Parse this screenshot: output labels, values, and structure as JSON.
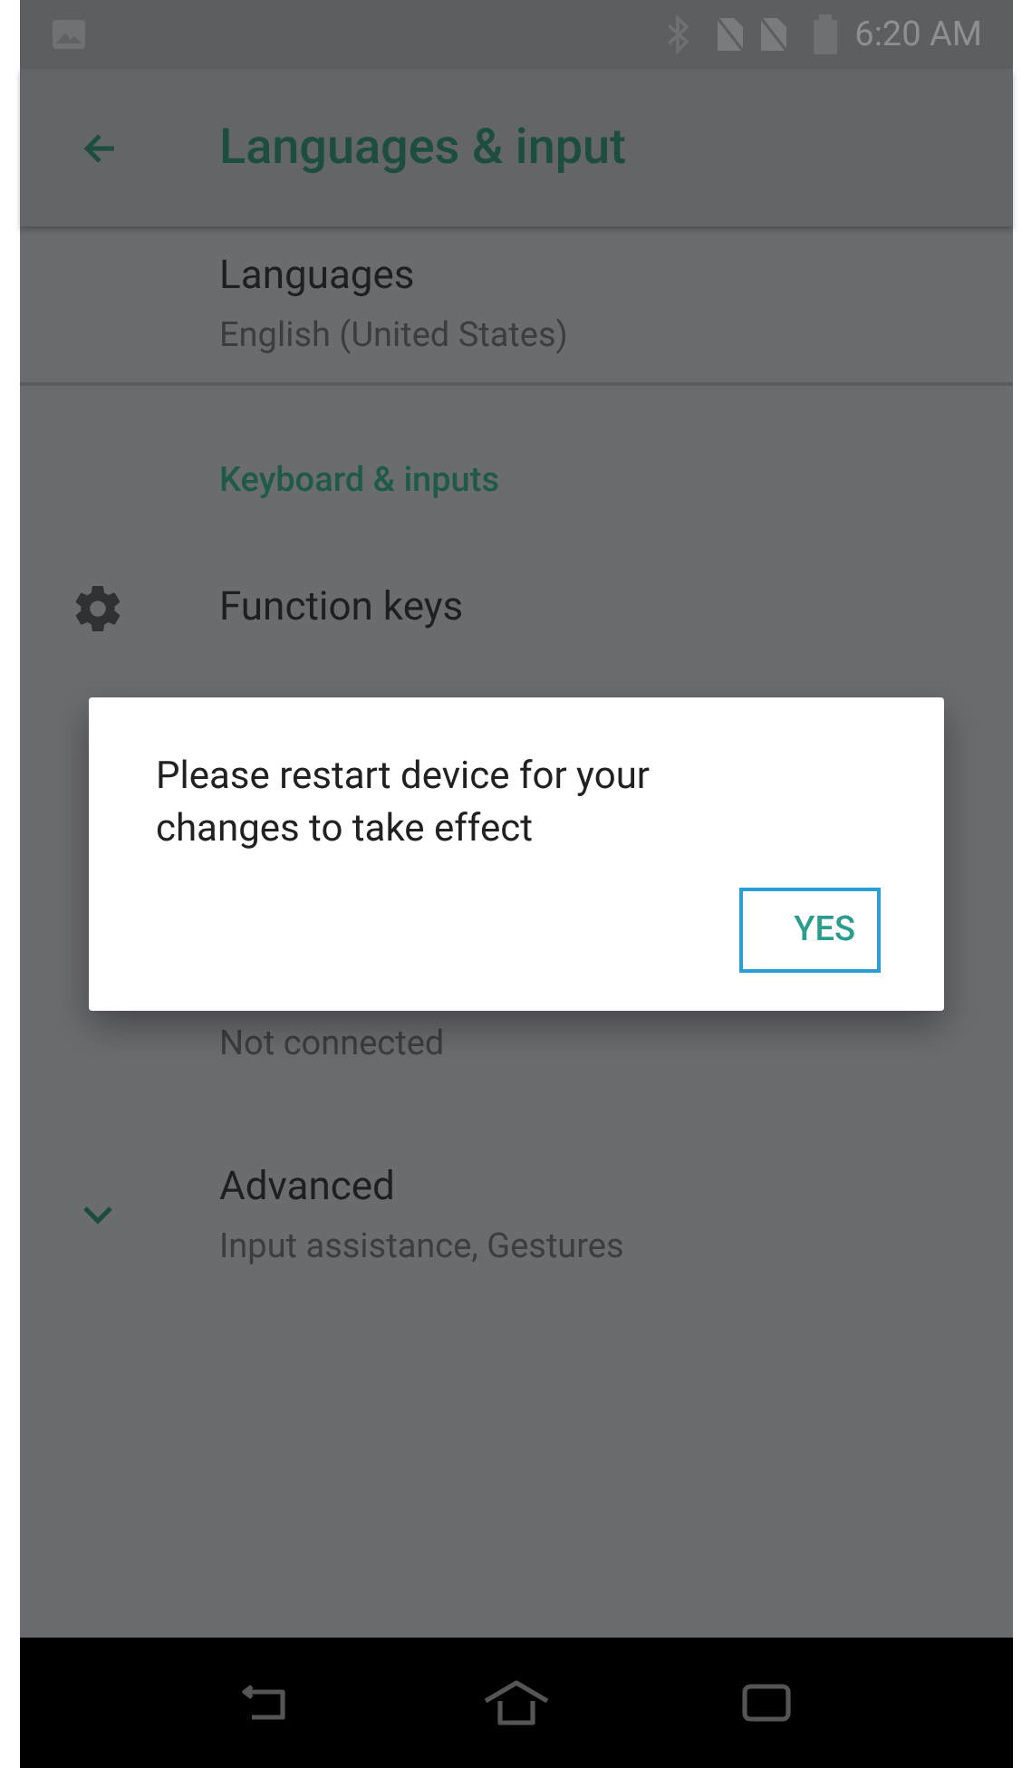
{
  "status_bar": {
    "time": "6:20 AM"
  },
  "toolbar": {
    "title": "Languages & input"
  },
  "items": [
    {
      "kind": "plain",
      "title": "Languages",
      "subtitle": "English (United States)"
    },
    {
      "kind": "header",
      "title": "Keyboard & inputs"
    },
    {
      "kind": "setting",
      "title": "Function keys"
    },
    {
      "kind": "plain",
      "subtitle": "Not connected"
    },
    {
      "kind": "expandable",
      "title": "Advanced",
      "subtitle": "Input assistance, Gestures"
    }
  ],
  "dialog": {
    "message": "Please restart device for your changes to take effect",
    "button": "YES"
  }
}
